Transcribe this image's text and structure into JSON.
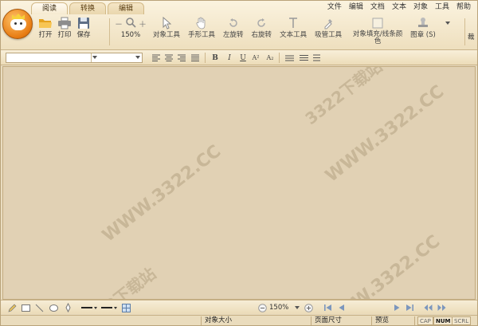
{
  "tabs": [
    {
      "label": "阅读",
      "active": true
    },
    {
      "label": "转换",
      "active": false
    },
    {
      "label": "编辑",
      "active": false
    }
  ],
  "menu": [
    "文件",
    "编辑",
    "文档",
    "文本",
    "对象",
    "工具",
    "帮助"
  ],
  "toolbar": {
    "open": "打开",
    "print": "打印",
    "save": "保存",
    "zoom_minus": "－",
    "zoom_plus": "＋",
    "zoom_value": "150%",
    "object_tool": "对象工具",
    "hand_tool": "手形工具",
    "rotate_left": "左旋转",
    "rotate_right": "右旋转",
    "text_tool": "文本工具",
    "eyedropper_tool": "吸管工具",
    "fill_line_color": "对象填充/线条颜色",
    "stamp": "图章 (S)",
    "more": "裁"
  },
  "format": {
    "bold": "B",
    "italic": "I",
    "underline": "U",
    "superscript": "A²",
    "subscript": "A₂"
  },
  "watermark": {
    "url": "WWW.3322.CC",
    "cn": "3322下载站"
  },
  "bottom": {
    "zoom_value": "150%"
  },
  "status": {
    "object_size": "对象大小",
    "page_size": "页面尺寸",
    "preview": "预览",
    "caps": "CAP",
    "num": "NUM",
    "scroll": "SCRL"
  },
  "colors": {
    "accent": "#e77b12",
    "canvas": "#e1d1b4",
    "ribbon": "#f6ead0",
    "folder": "#f0b030",
    "save": "#3f7fc8"
  }
}
